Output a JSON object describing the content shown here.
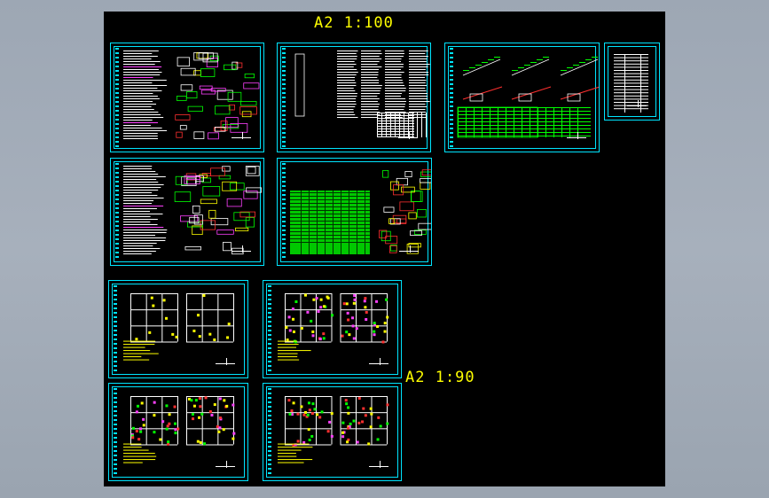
{
  "labels": {
    "top": "A2  1:100",
    "mid": "A2  1:90"
  },
  "sheets": [
    {
      "id": "sheet-1",
      "kind": "notes"
    },
    {
      "id": "sheet-2",
      "kind": "details"
    },
    {
      "id": "sheet-3",
      "kind": "stairs"
    },
    {
      "id": "sheet-4",
      "kind": "index"
    },
    {
      "id": "sheet-5",
      "kind": "notes"
    },
    {
      "id": "sheet-6",
      "kind": "table"
    },
    {
      "id": "sheet-7",
      "kind": "plan-sparse"
    },
    {
      "id": "sheet-8",
      "kind": "plan-dense"
    },
    {
      "id": "sheet-9",
      "kind": "plan-dense"
    },
    {
      "id": "sheet-10",
      "kind": "plan-dense"
    }
  ],
  "colors": {
    "canvas": "#000000",
    "frame": "#00e5ff",
    "label": "#ffff00",
    "green": "#00ff00",
    "red": "#ff3030",
    "magenta": "#ff40ff",
    "white": "#ffffff"
  }
}
